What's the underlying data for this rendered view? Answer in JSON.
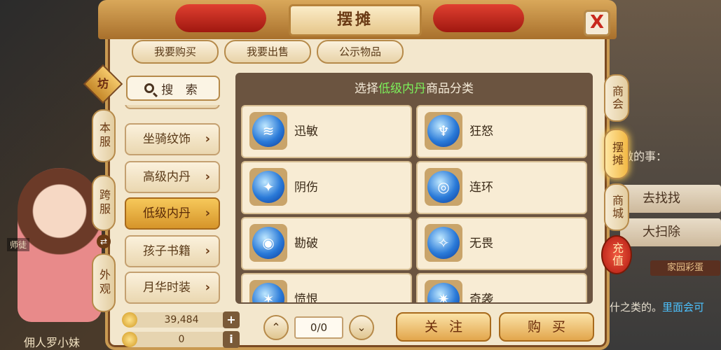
{
  "title": "摆摊",
  "close_label": "X",
  "top_tabs": [
    {
      "label": "我要购买"
    },
    {
      "label": "我要出售"
    },
    {
      "label": "公示物品"
    }
  ],
  "left_tabs": {
    "badge": "坊",
    "items": [
      {
        "label": "本服"
      },
      {
        "label": "跨服"
      },
      {
        "label": "外观"
      }
    ],
    "swap_icon": "⇄"
  },
  "search": {
    "label": "搜 索",
    "icon": "search-icon"
  },
  "categories": [
    {
      "label": "坐骑纹饰",
      "active": false
    },
    {
      "label": "高级内丹",
      "active": false
    },
    {
      "label": "低级内丹",
      "active": true
    },
    {
      "label": "孩子书籍",
      "active": false
    },
    {
      "label": "月华时装",
      "active": false
    }
  ],
  "chevron": "›",
  "main": {
    "header_prefix": "选择",
    "header_highlight": "低级内丹",
    "header_suffix": "商品分类",
    "items": [
      {
        "name": "迅敏",
        "icon": "ball-swift-icon"
      },
      {
        "name": "狂怒",
        "icon": "rage-icon"
      },
      {
        "name": "阴伤",
        "icon": "shadow-wound-icon"
      },
      {
        "name": "连环",
        "icon": "chain-icon"
      },
      {
        "name": "勘破",
        "icon": "eye-icon"
      },
      {
        "name": "无畏",
        "icon": "fearless-icon"
      },
      {
        "name": "愤恨",
        "icon": "hatred-icon"
      },
      {
        "name": "奇袭",
        "icon": "ambush-icon"
      }
    ]
  },
  "currency": [
    {
      "value": "39,484",
      "action": "+"
    },
    {
      "value": "0",
      "action": "i"
    }
  ],
  "pager": {
    "up": "⌃",
    "value": "0/0",
    "down": "⌄"
  },
  "actions": {
    "follow": "关注",
    "buy": "购买"
  },
  "right_tabs": [
    {
      "label": "商会"
    },
    {
      "label": "摆摊"
    },
    {
      "label": "商城"
    },
    {
      "label": "充值"
    }
  ],
  "background": {
    "task_prompt": "要做的事：",
    "task_buttons": [
      "去找找",
      "大扫除"
    ],
    "egg_label": "家园彩蛋",
    "hint_prefix": "什之类的。",
    "hint_highlight": "里面会可",
    "npc_name": "佣人罗小妹",
    "side_label": "师徒"
  },
  "colors": {
    "accent": "#d6952a",
    "highlight_green": "#7cf05a",
    "close_red": "#c8281e"
  }
}
